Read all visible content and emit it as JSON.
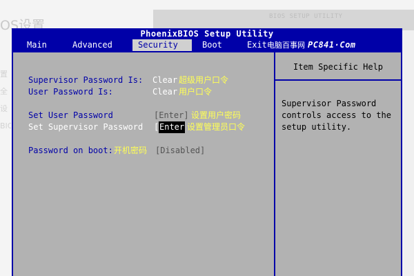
{
  "background": {
    "page_title_fragment": "OS设置",
    "side_fragments": [
      "置",
      "全",
      "设",
      "BIOS"
    ],
    "top_caption": "BIOS SETUP UTILITY"
  },
  "bios": {
    "title": "PhoenixBIOS Setup Utility",
    "menu": [
      {
        "label": "Main",
        "active": false
      },
      {
        "label": "Advanced",
        "active": false
      },
      {
        "label": "Security",
        "active": true
      },
      {
        "label": "Boot",
        "active": false
      },
      {
        "label": "Exit",
        "active": false
      }
    ],
    "brand_cn": "电脑百事网",
    "brand_logo": "PC841·Com",
    "items": {
      "supervisor_status": {
        "label": "Supervisor Password Is:",
        "value": "Clear",
        "note": "超级用户口令"
      },
      "user_status": {
        "label": "User Password Is:",
        "value": "Clear",
        "note": "用户口令"
      },
      "set_user": {
        "label": "Set User Password",
        "value": "[Enter]",
        "note": "设置用户密码"
      },
      "set_supervisor": {
        "label": "Set Supervisor Password",
        "value": "[Enter]",
        "value_open": "[",
        "value_highlight": "Enter",
        "note": "设置管理员口令"
      },
      "password_on_boot": {
        "label": "Password on boot:",
        "note": "开机密码",
        "value": "[Disabled]"
      }
    },
    "help": {
      "title": "Item Specific Help",
      "lines": [
        "Supervisor Password",
        "controls access to the",
        "setup utility."
      ]
    }
  },
  "colors": {
    "bios_blue": "#0000a8",
    "panel_gray": "#b2b2b2",
    "annotation_yellow": "#ffff55"
  }
}
